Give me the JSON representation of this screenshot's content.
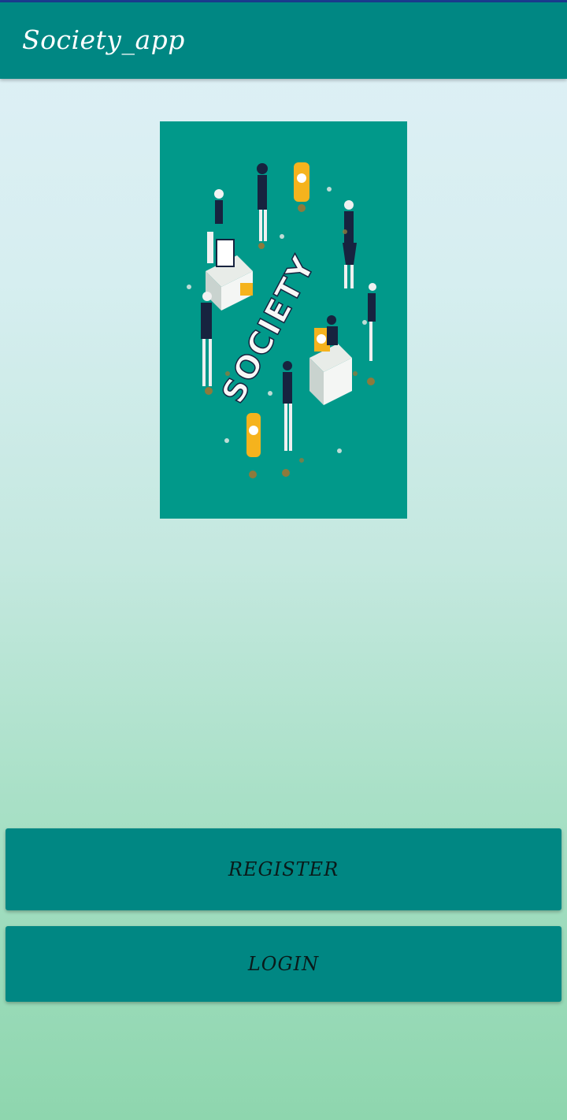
{
  "app_bar": {
    "title": "Society_app"
  },
  "hero_image": {
    "caption": "SOCIETY",
    "background_color": "#01998a"
  },
  "actions": {
    "register_label": "REGISTER",
    "login_label": "LOGIN"
  },
  "theme": {
    "primary": "#008783",
    "status_line": "#1b3a8f",
    "gradient_top": "#dff0f6",
    "gradient_bottom": "#8ed6ae"
  }
}
